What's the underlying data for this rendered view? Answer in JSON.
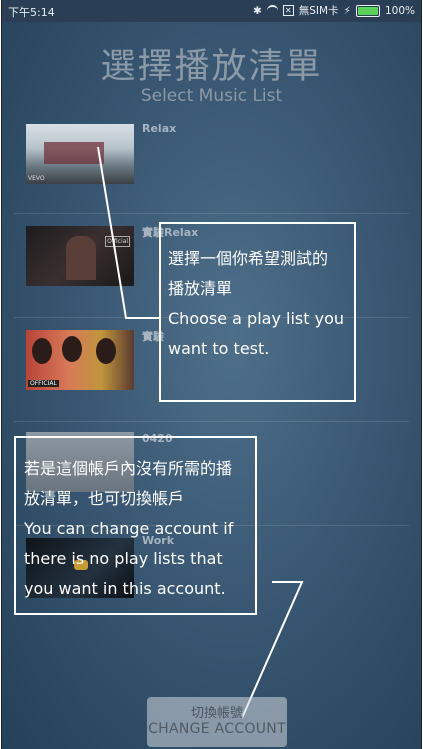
{
  "status_bar": {
    "time": "下午5:14",
    "sim_text": "無SIM卡",
    "battery": "100%",
    "icons": [
      "bluetooth-icon",
      "wifi-icon",
      "no-sim-icon",
      "charging-icon",
      "battery-icon"
    ]
  },
  "header": {
    "title": "選擇播放清單",
    "subtitle": "Select Music List"
  },
  "playlists": [
    {
      "name": "Relax",
      "thumb_badge": "VEVO"
    },
    {
      "name": "實驗Relax",
      "thumb_badge": "Official"
    },
    {
      "name": "實驗",
      "thumb_badge": "OFFICIAL"
    },
    {
      "name": "0420",
      "thumb_badge": ""
    },
    {
      "name": "Work",
      "thumb_badge": ""
    }
  ],
  "callout_select": {
    "line1": "選擇一個你希望測試的",
    "line2": "播放清單",
    "line3": "Choose a play list you",
    "line4": "want to test."
  },
  "callout_change": {
    "line1": "若是這個帳戶內沒有所需的播",
    "line2": "放清單，也可切換帳戶",
    "line3": "You can change account if",
    "line4": "there is no play lists that",
    "line5": "you want in this account."
  },
  "change_button": {
    "label_zh": "切換帳號",
    "label_en": "CHANGE ACCOUNT"
  },
  "colors": {
    "background": "#3a5873",
    "status_bar": "#2a3f55",
    "battery_fill": "#5bd35b",
    "callout_border": "#ffffff"
  }
}
